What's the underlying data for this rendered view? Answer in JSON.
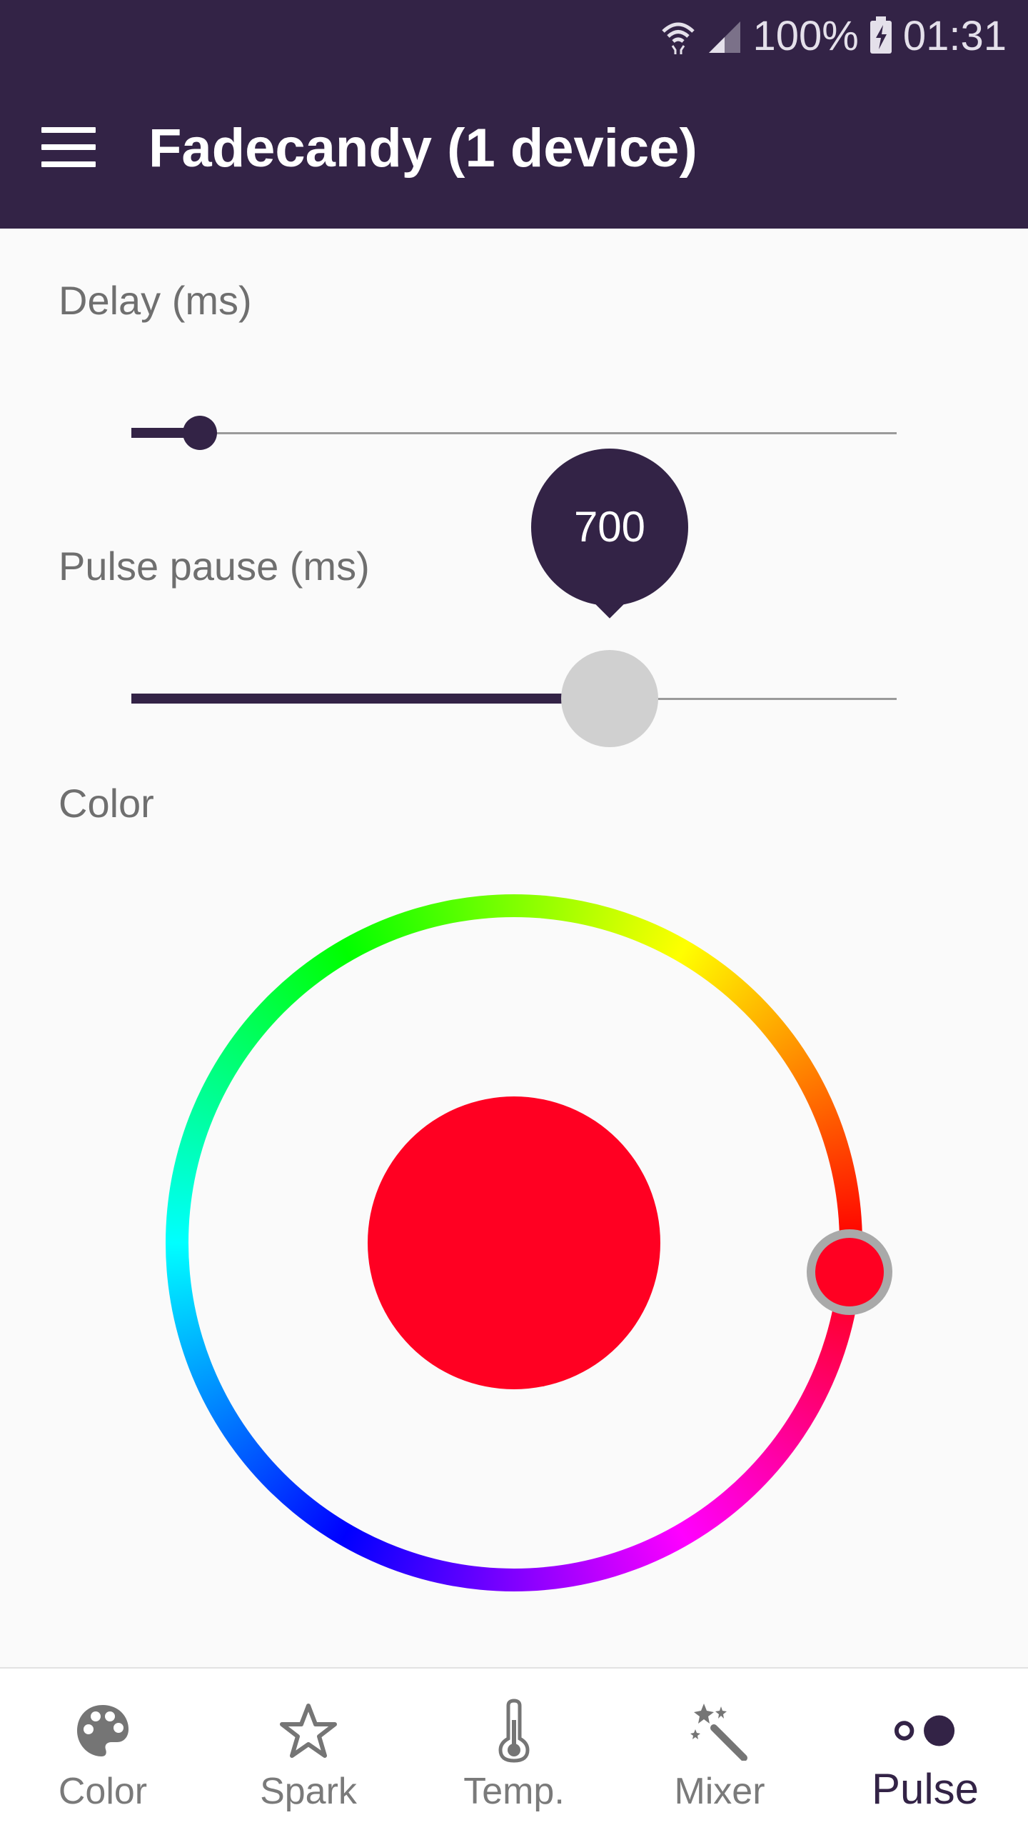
{
  "status_bar": {
    "icons": [
      "wifi-icon",
      "signal-icon",
      "battery-charging-icon"
    ],
    "battery": "100%",
    "time": "01:31"
  },
  "app_bar": {
    "menu_icon": "menu-icon",
    "title": "Fadecandy (1 device)"
  },
  "delay": {
    "label": "Delay (ms)",
    "value_fraction": 0.09
  },
  "pulse_pause": {
    "label": "Pulse pause (ms)",
    "value": "700",
    "value_fraction": 0.625
  },
  "color": {
    "label": "Color",
    "selected_color": "#ff0022",
    "hue_handle_angle_deg": 95
  },
  "colors": {
    "primary": "#332346",
    "background": "#fafafa",
    "inactive_text": "#7a7a7a"
  },
  "bottom_nav": {
    "items": [
      {
        "label": "Color",
        "icon": "palette-icon",
        "active": false
      },
      {
        "label": "Spark",
        "icon": "star-icon",
        "active": false
      },
      {
        "label": "Temp.",
        "icon": "thermometer-icon",
        "active": false
      },
      {
        "label": "Mixer",
        "icon": "magic-wand-icon",
        "active": false
      },
      {
        "label": "Pulse",
        "icon": "pulse-dots-icon",
        "active": true
      }
    ]
  }
}
